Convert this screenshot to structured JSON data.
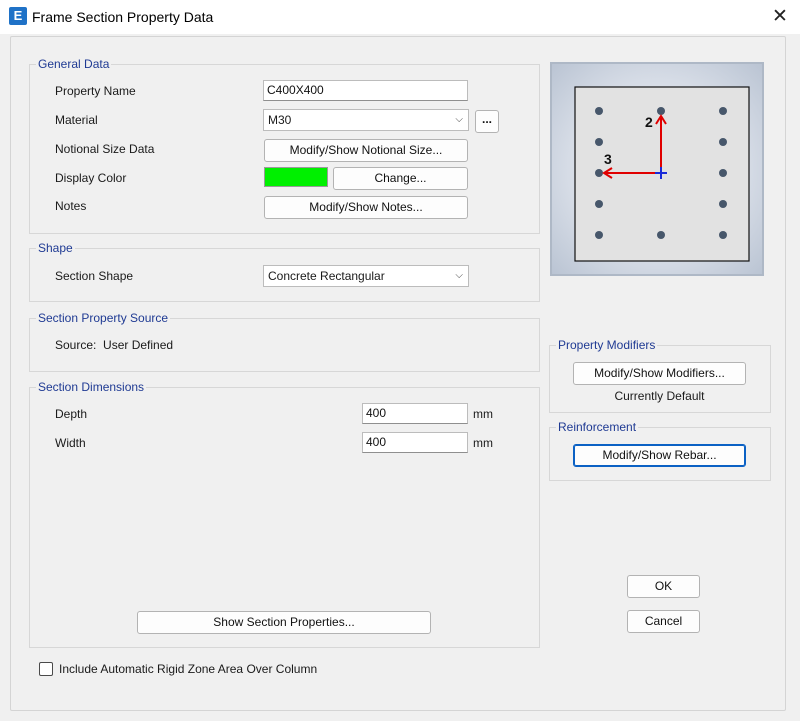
{
  "window": {
    "title": "Frame Section Property Data",
    "app_icon_letter": "E"
  },
  "general_data": {
    "title": "General Data",
    "property_name_label": "Property Name",
    "property_name_value": "C400X400",
    "material_label": "Material",
    "material_value": "M30",
    "material_more_label": "...",
    "notional_label": "Notional Size Data",
    "notional_button": "Modify/Show Notional Size...",
    "display_color_label": "Display Color",
    "display_color": "#00f000",
    "change_button": "Change...",
    "notes_label": "Notes",
    "notes_button": "Modify/Show Notes..."
  },
  "shape": {
    "title": "Shape",
    "section_shape_label": "Section Shape",
    "section_shape_value": "Concrete Rectangular"
  },
  "source": {
    "title": "Section Property Source",
    "text": "Source:  User Defined"
  },
  "dimensions": {
    "title": "Section Dimensions",
    "depth_label": "Depth",
    "depth_value": "400",
    "depth_unit": "mm",
    "width_label": "Width",
    "width_value": "400",
    "width_unit": "mm",
    "show_props_button": "Show Section Properties..."
  },
  "preview": {
    "axis2_label": "2",
    "axis3_label": "3"
  },
  "modifiers": {
    "title": "Property Modifiers",
    "button": "Modify/Show Modifiers...",
    "status": "Currently Default"
  },
  "reinforcement": {
    "title": "Reinforcement",
    "button": "Modify/Show Rebar..."
  },
  "actions": {
    "ok": "OK",
    "cancel": "Cancel"
  },
  "rigid_zone": {
    "label": "Include Automatic Rigid Zone Area Over Column",
    "checked": false
  }
}
